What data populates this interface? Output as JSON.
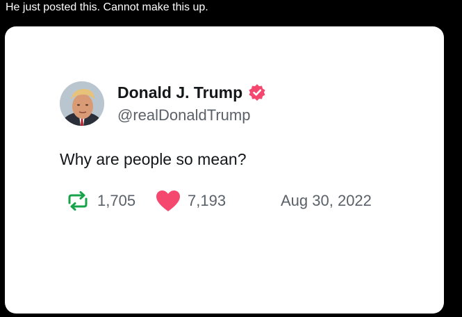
{
  "caption": "He just posted this. Cannot make this up.",
  "tweet": {
    "author_name": "Donald J. Trump",
    "handle": "@realDonaldTrump",
    "text": "Why are people so mean?",
    "retweets": "1,705",
    "likes": "7,193",
    "date": "Aug 30, 2022",
    "verified": true
  },
  "icons": {
    "avatar": "profile-photo",
    "verified": "verified-badge-icon",
    "retweet": "retweet-icon",
    "like": "heart-icon"
  },
  "colors": {
    "background": "#000000",
    "card": "#ffffff",
    "verified_badge": "#f4486f",
    "retweet_icon": "#17a34a",
    "heart_icon": "#f4486f",
    "muted_text": "#5b6169",
    "primary_text": "#14171a"
  }
}
